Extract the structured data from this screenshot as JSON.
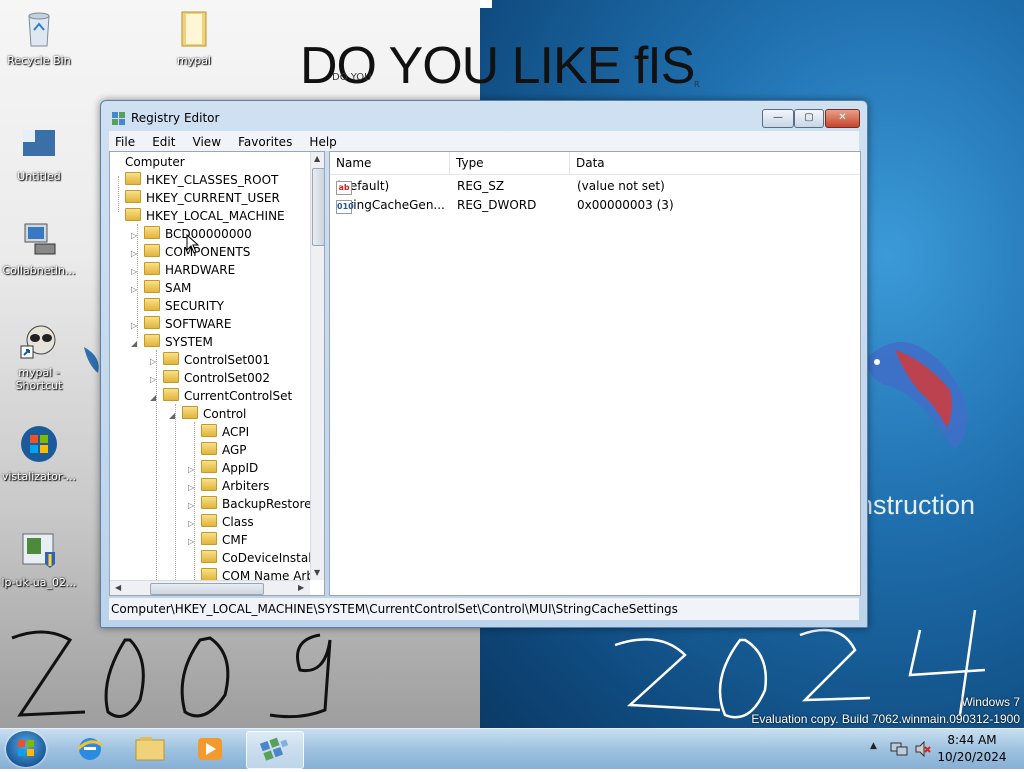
{
  "desktop": {
    "icons": [
      {
        "label": "Recycle Bin",
        "icon": "recycle-bin-icon"
      },
      {
        "label": "mypal",
        "icon": "folder-icon"
      },
      {
        "label": "Untitled",
        "icon": "document-icon"
      },
      {
        "label": "CollabnetIn...",
        "icon": "installer-icon"
      },
      {
        "label": "mypal - Shortcut",
        "icon": "raccoon-shortcut-icon"
      },
      {
        "label": "vistalizator-...",
        "icon": "windows-logo-icon"
      },
      {
        "label": "lp-uk-ua_02...",
        "icon": "language-pack-icon"
      }
    ],
    "doodle_heading": "DO YOU LIKE fIS",
    "doodle_small": "DO YOU",
    "doodle_mark": "R",
    "handwritten_left": "2009",
    "handwritten_right": "2024",
    "wallpaper_text": "nstruction",
    "watermark_line1": "Windows 7",
    "watermark_line2": "Evaluation copy. Build 7062.winmain.090312-1900"
  },
  "window": {
    "title": "Registry Editor",
    "buttons": {
      "minimize": "—",
      "maximize": "▢",
      "close": "✕"
    },
    "menu": [
      "File",
      "Edit",
      "View",
      "Favorites",
      "Help"
    ],
    "tree": [
      {
        "label": "Computer",
        "level": 0,
        "expander": ""
      },
      {
        "label": "HKEY_CLASSES_ROOT",
        "level": 1,
        "expander": ""
      },
      {
        "label": "HKEY_CURRENT_USER",
        "level": 1,
        "expander": ""
      },
      {
        "label": "HKEY_LOCAL_MACHINE",
        "level": 1,
        "expander": ""
      },
      {
        "label": "BCD00000000",
        "level": 2,
        "expander": "▷"
      },
      {
        "label": "COMPONENTS",
        "level": 2,
        "expander": "▷"
      },
      {
        "label": "HARDWARE",
        "level": 2,
        "expander": "▷"
      },
      {
        "label": "SAM",
        "level": 2,
        "expander": "▷"
      },
      {
        "label": "SECURITY",
        "level": 2,
        "expander": ""
      },
      {
        "label": "SOFTWARE",
        "level": 2,
        "expander": "▷"
      },
      {
        "label": "SYSTEM",
        "level": 2,
        "expander": "◢"
      },
      {
        "label": "ControlSet001",
        "level": 3,
        "expander": "▷"
      },
      {
        "label": "ControlSet002",
        "level": 3,
        "expander": "▷"
      },
      {
        "label": "CurrentControlSet",
        "level": 3,
        "expander": "◢"
      },
      {
        "label": "Control",
        "level": 4,
        "expander": "◢"
      },
      {
        "label": "ACPI",
        "level": 5,
        "expander": ""
      },
      {
        "label": "AGP",
        "level": 5,
        "expander": ""
      },
      {
        "label": "AppID",
        "level": 5,
        "expander": "▷"
      },
      {
        "label": "Arbiters",
        "level": 5,
        "expander": "▷"
      },
      {
        "label": "BackupRestore",
        "level": 5,
        "expander": "▷"
      },
      {
        "label": "Class",
        "level": 5,
        "expander": "▷"
      },
      {
        "label": "CMF",
        "level": 5,
        "expander": "▷"
      },
      {
        "label": "CoDeviceInstallers",
        "level": 5,
        "expander": ""
      },
      {
        "label": "COM Name Arbit",
        "level": 5,
        "expander": ""
      }
    ],
    "columns": [
      "Name",
      "Type",
      "Data"
    ],
    "values": [
      {
        "icon": "ab",
        "name": "(Default)",
        "type": "REG_SZ",
        "data": "(value not set)"
      },
      {
        "icon": "010",
        "name": "StringCacheGen...",
        "type": "REG_DWORD",
        "data": "0x00000003 (3)"
      }
    ],
    "status": "Computer\\HKEY_LOCAL_MACHINE\\SYSTEM\\CurrentControlSet\\Control\\MUI\\StringCacheSettings"
  },
  "taskbar": {
    "apps": [
      "internet-explorer-icon",
      "file-explorer-icon",
      "media-player-icon",
      "registry-editor-icon"
    ],
    "time": "8:44 AM",
    "date": "10/20/2024",
    "tray_icons": [
      "show-hidden-icons-icon",
      "network-icon",
      "volume-muted-icon"
    ]
  },
  "colors": {
    "accent": "#1f6fae",
    "window_frame": "#bcd3ec",
    "close_button": "#c7442b"
  }
}
